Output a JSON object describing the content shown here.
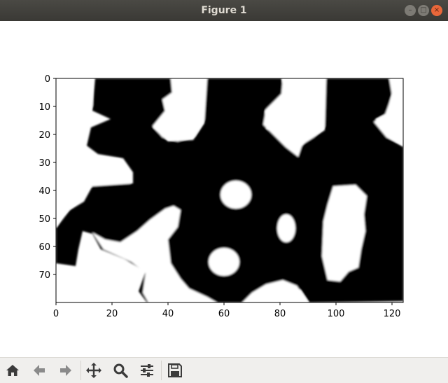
{
  "window": {
    "title": "Figure 1"
  },
  "chart_data": {
    "type": "heatmap",
    "title": "",
    "xlabel": "",
    "ylabel": "",
    "xlim": [
      0,
      124
    ],
    "ylim": [
      80,
      0
    ],
    "xticks": [
      "0",
      "20",
      "40",
      "60",
      "80",
      "100",
      "120"
    ],
    "yticks": [
      "0",
      "10",
      "20",
      "30",
      "40",
      "50",
      "60",
      "70"
    ],
    "colormap": "gray",
    "values_description": "binary image, black = 0, white = 1"
  },
  "toolbar": {
    "buttons": [
      {
        "name": "home-button",
        "icon": "home-icon"
      },
      {
        "name": "back-button",
        "icon": "arrow-left-icon"
      },
      {
        "name": "forward-button",
        "icon": "arrow-right-icon"
      },
      {
        "name": "pan-button",
        "icon": "move-icon"
      },
      {
        "name": "zoom-button",
        "icon": "zoom-icon"
      },
      {
        "name": "configure-button",
        "icon": "sliders-icon"
      },
      {
        "name": "save-button",
        "icon": "floppy-icon"
      }
    ]
  },
  "colors": {
    "titlebar": "#3c3b37",
    "toolbar": "#f0efed",
    "foreground": "#000000",
    "background": "#ffffff"
  }
}
